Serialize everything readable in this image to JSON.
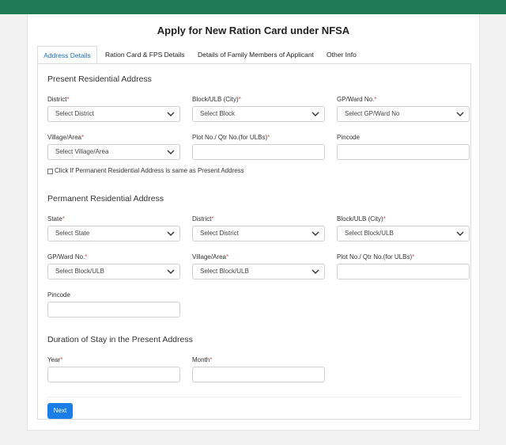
{
  "page": {
    "title": "Apply for New Ration Card under NFSA"
  },
  "tabs": [
    {
      "label": "Address Details",
      "active": true
    },
    {
      "label": "Ration Card & FPS Details",
      "active": false
    },
    {
      "label": "Details of Family Members of Applicant",
      "active": false
    },
    {
      "label": "Other Info",
      "active": false
    }
  ],
  "present": {
    "heading": "Present Residential Address",
    "district_label": "District",
    "district_value": "Select District",
    "block_label": "Block/ULB (City)",
    "block_value": "Select Block",
    "gp_label": "GP/Ward No.",
    "gp_value": "Select GP/Ward No",
    "village_label": "Village/Area",
    "village_value": "Select Village/Area",
    "plot_label": "Plot No./ Qtr No.(for ULBs)",
    "plot_value": "",
    "pincode_label": "Pincode",
    "pincode_value": "",
    "same_checkbox_label": "Click If Permanent Residential Address is same as Present Address"
  },
  "permanent": {
    "heading": "Permanent Residential Address",
    "state_label": "State",
    "state_value": "Select State",
    "district_label": "District",
    "district_value": "Select District",
    "block_label": "Block/ULB (City)",
    "block_value": "Select Block/ULB",
    "gp_label": "GP/Ward No.",
    "gp_value": "Select Block/ULB",
    "village_label": "Village/Area",
    "village_value": "Select Block/ULB",
    "plot_label": "Plot No./ Qtr No.(for ULBs)",
    "plot_value": "",
    "pincode_label": "Pincode",
    "pincode_value": ""
  },
  "duration": {
    "heading": "Duration of Stay in the Present Address",
    "year_label": "Year",
    "year_value": "",
    "month_label": "Month",
    "month_value": ""
  },
  "required_marker": "*",
  "buttons": {
    "next_label": "Next"
  },
  "colors": {
    "header_bar": "#1e7a57",
    "primary_button": "#1a7ee6",
    "active_tab_text": "#1a6fc0",
    "required_marker": "#d9534f"
  },
  "icons": {
    "dropdown": "chevron-down-icon"
  }
}
